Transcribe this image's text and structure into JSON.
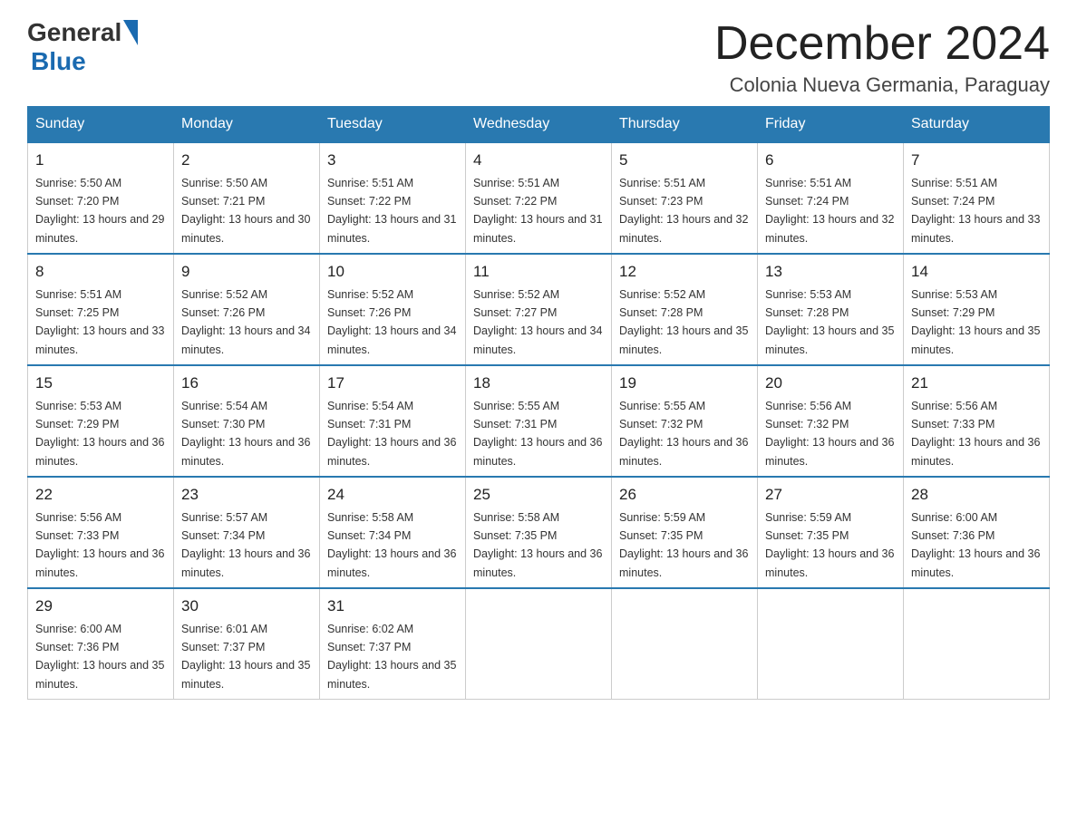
{
  "logo": {
    "general": "General",
    "blue": "Blue"
  },
  "title": "December 2024",
  "location": "Colonia Nueva Germania, Paraguay",
  "days_of_week": [
    "Sunday",
    "Monday",
    "Tuesday",
    "Wednesday",
    "Thursday",
    "Friday",
    "Saturday"
  ],
  "weeks": [
    [
      {
        "day": "1",
        "sunrise": "5:50 AM",
        "sunset": "7:20 PM",
        "daylight": "13 hours and 29 minutes."
      },
      {
        "day": "2",
        "sunrise": "5:50 AM",
        "sunset": "7:21 PM",
        "daylight": "13 hours and 30 minutes."
      },
      {
        "day": "3",
        "sunrise": "5:51 AM",
        "sunset": "7:22 PM",
        "daylight": "13 hours and 31 minutes."
      },
      {
        "day": "4",
        "sunrise": "5:51 AM",
        "sunset": "7:22 PM",
        "daylight": "13 hours and 31 minutes."
      },
      {
        "day": "5",
        "sunrise": "5:51 AM",
        "sunset": "7:23 PM",
        "daylight": "13 hours and 32 minutes."
      },
      {
        "day": "6",
        "sunrise": "5:51 AM",
        "sunset": "7:24 PM",
        "daylight": "13 hours and 32 minutes."
      },
      {
        "day": "7",
        "sunrise": "5:51 AM",
        "sunset": "7:24 PM",
        "daylight": "13 hours and 33 minutes."
      }
    ],
    [
      {
        "day": "8",
        "sunrise": "5:51 AM",
        "sunset": "7:25 PM",
        "daylight": "13 hours and 33 minutes."
      },
      {
        "day": "9",
        "sunrise": "5:52 AM",
        "sunset": "7:26 PM",
        "daylight": "13 hours and 34 minutes."
      },
      {
        "day": "10",
        "sunrise": "5:52 AM",
        "sunset": "7:26 PM",
        "daylight": "13 hours and 34 minutes."
      },
      {
        "day": "11",
        "sunrise": "5:52 AM",
        "sunset": "7:27 PM",
        "daylight": "13 hours and 34 minutes."
      },
      {
        "day": "12",
        "sunrise": "5:52 AM",
        "sunset": "7:28 PM",
        "daylight": "13 hours and 35 minutes."
      },
      {
        "day": "13",
        "sunrise": "5:53 AM",
        "sunset": "7:28 PM",
        "daylight": "13 hours and 35 minutes."
      },
      {
        "day": "14",
        "sunrise": "5:53 AM",
        "sunset": "7:29 PM",
        "daylight": "13 hours and 35 minutes."
      }
    ],
    [
      {
        "day": "15",
        "sunrise": "5:53 AM",
        "sunset": "7:29 PM",
        "daylight": "13 hours and 36 minutes."
      },
      {
        "day": "16",
        "sunrise": "5:54 AM",
        "sunset": "7:30 PM",
        "daylight": "13 hours and 36 minutes."
      },
      {
        "day": "17",
        "sunrise": "5:54 AM",
        "sunset": "7:31 PM",
        "daylight": "13 hours and 36 minutes."
      },
      {
        "day": "18",
        "sunrise": "5:55 AM",
        "sunset": "7:31 PM",
        "daylight": "13 hours and 36 minutes."
      },
      {
        "day": "19",
        "sunrise": "5:55 AM",
        "sunset": "7:32 PM",
        "daylight": "13 hours and 36 minutes."
      },
      {
        "day": "20",
        "sunrise": "5:56 AM",
        "sunset": "7:32 PM",
        "daylight": "13 hours and 36 minutes."
      },
      {
        "day": "21",
        "sunrise": "5:56 AM",
        "sunset": "7:33 PM",
        "daylight": "13 hours and 36 minutes."
      }
    ],
    [
      {
        "day": "22",
        "sunrise": "5:56 AM",
        "sunset": "7:33 PM",
        "daylight": "13 hours and 36 minutes."
      },
      {
        "day": "23",
        "sunrise": "5:57 AM",
        "sunset": "7:34 PM",
        "daylight": "13 hours and 36 minutes."
      },
      {
        "day": "24",
        "sunrise": "5:58 AM",
        "sunset": "7:34 PM",
        "daylight": "13 hours and 36 minutes."
      },
      {
        "day": "25",
        "sunrise": "5:58 AM",
        "sunset": "7:35 PM",
        "daylight": "13 hours and 36 minutes."
      },
      {
        "day": "26",
        "sunrise": "5:59 AM",
        "sunset": "7:35 PM",
        "daylight": "13 hours and 36 minutes."
      },
      {
        "day": "27",
        "sunrise": "5:59 AM",
        "sunset": "7:35 PM",
        "daylight": "13 hours and 36 minutes."
      },
      {
        "day": "28",
        "sunrise": "6:00 AM",
        "sunset": "7:36 PM",
        "daylight": "13 hours and 36 minutes."
      }
    ],
    [
      {
        "day": "29",
        "sunrise": "6:00 AM",
        "sunset": "7:36 PM",
        "daylight": "13 hours and 35 minutes."
      },
      {
        "day": "30",
        "sunrise": "6:01 AM",
        "sunset": "7:37 PM",
        "daylight": "13 hours and 35 minutes."
      },
      {
        "day": "31",
        "sunrise": "6:02 AM",
        "sunset": "7:37 PM",
        "daylight": "13 hours and 35 minutes."
      },
      null,
      null,
      null,
      null
    ]
  ]
}
